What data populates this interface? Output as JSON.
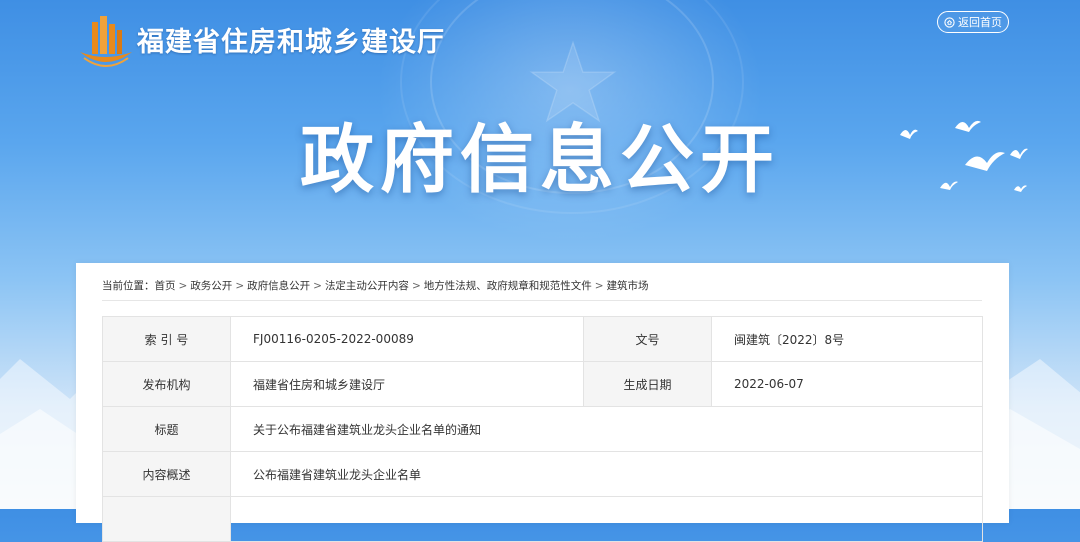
{
  "header": {
    "site_title": "福建省住房和城乡建设厅",
    "home_button": "返回首页"
  },
  "banner": {
    "title": "政府信息公开"
  },
  "breadcrumb": {
    "prefix": "当前位置：",
    "items": [
      "首页",
      "政务公开",
      "政府信息公开",
      "法定主动公开内容",
      "地方性法规、政府规章和规范性文件",
      "建筑市场"
    ],
    "separator": ">"
  },
  "info_table": {
    "index_label": "索 引 号",
    "index_value": "FJ00116-0205-2022-00089",
    "doc_no_label": "文号",
    "doc_no_value": "闽建筑〔2022〕8号",
    "publisher_label": "发布机构",
    "publisher_value": "福建省住房和城乡建设厅",
    "date_label": "生成日期",
    "date_value": "2022-06-07",
    "title_label": "标题",
    "title_value": "关于公布福建省建筑业龙头企业名单的通知",
    "summary_label": "内容概述",
    "summary_value": "公布福建省建筑业龙头企业名单"
  },
  "colors": {
    "sky_top": "#3f8fe4",
    "panel_bg": "#ffffff",
    "label_bg": "#f5f5f5",
    "logo_orange": "#e88a1c"
  },
  "icons": [
    "logo-emblem",
    "home-icon",
    "star-emblem-icon",
    "dove-icon"
  ]
}
